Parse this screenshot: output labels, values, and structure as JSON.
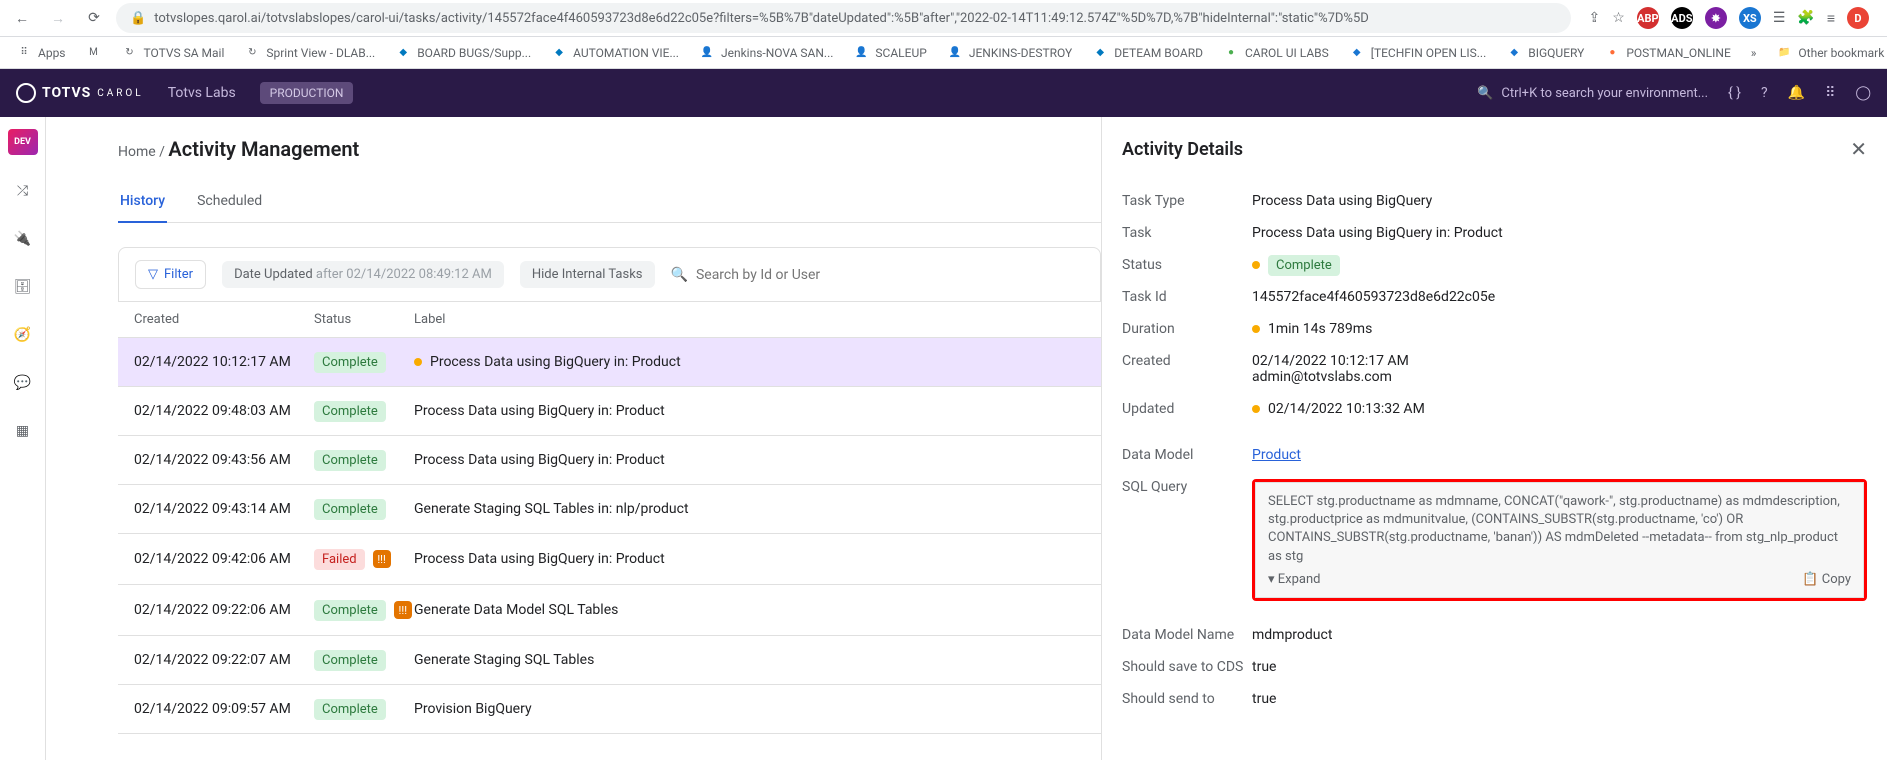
{
  "browser": {
    "url": "totvslopes.qarol.ai/totvslabslopes/carol-ui/tasks/activity/145572face4f460593723d8e6d22c05e?filters=%5B%7B\"dateUpdated\":%5B\"after\",\"2022-02-14T11:49:12.574Z\"%5D%7D,%7B\"hideInternal\":\"static\"%7D%5D",
    "other_bookmarks": "Other bookmark"
  },
  "bookmarks": {
    "apps": "Apps",
    "items": [
      "TOTVS SA Mail",
      "Sprint View - DLAB...",
      "BOARD BUGS/Supp...",
      "AUTOMATION VIE...",
      "Jenkins-NOVA SAN...",
      "SCALEUP",
      "JENKINS-DESTROY",
      "DETEAM BOARD",
      "CAROL UI LABS",
      "[TECHFIN OPEN LIS...",
      "BIGQUERY",
      "POSTMAN_ONLINE"
    ]
  },
  "header": {
    "brand": "TOTVS",
    "brand_sub": "CAROL",
    "org": "Totvs Labs",
    "env": "PRODUCTION",
    "search_placeholder": "Ctrl+K to search your environment..."
  },
  "page": {
    "home": "Home",
    "title": "Activity Management",
    "tabs": {
      "history": "History",
      "scheduled": "Scheduled"
    },
    "filter_label": "Filter",
    "date_chip_prefix": "Date Updated",
    "date_chip_after": "after 02/14/2022 08:49:12 AM",
    "hide_internal": "Hide Internal Tasks",
    "search_placeholder": "Search by Id or User"
  },
  "table": {
    "cols": {
      "created": "Created",
      "status": "Status",
      "label": "Label"
    },
    "rows": [
      {
        "created": "02/14/2022 10:12:17 AM",
        "status": "Complete",
        "status_type": "complete",
        "warn": false,
        "dot": true,
        "label": "Process Data using BigQuery in: Product",
        "selected": true
      },
      {
        "created": "02/14/2022 09:48:03 AM",
        "status": "Complete",
        "status_type": "complete",
        "warn": false,
        "dot": false,
        "label": "Process Data using BigQuery in: Product"
      },
      {
        "created": "02/14/2022 09:43:56 AM",
        "status": "Complete",
        "status_type": "complete",
        "warn": false,
        "dot": false,
        "label": "Process Data using BigQuery in: Product"
      },
      {
        "created": "02/14/2022 09:43:14 AM",
        "status": "Complete",
        "status_type": "complete",
        "warn": false,
        "dot": false,
        "label": "Generate Staging SQL Tables in: nlp/product"
      },
      {
        "created": "02/14/2022 09:42:06 AM",
        "status": "Failed",
        "status_type": "failed",
        "warn": true,
        "dot": false,
        "label": "Process Data using BigQuery in: Product"
      },
      {
        "created": "02/14/2022 09:22:06 AM",
        "status": "Complete",
        "status_type": "complete",
        "warn": true,
        "dot": false,
        "label": "Generate Data Model SQL Tables"
      },
      {
        "created": "02/14/2022 09:22:07 AM",
        "status": "Complete",
        "status_type": "complete",
        "warn": false,
        "dot": false,
        "label": "Generate Staging SQL Tables"
      },
      {
        "created": "02/14/2022 09:09:57 AM",
        "status": "Complete",
        "status_type": "complete",
        "warn": false,
        "dot": false,
        "label": "Provision BigQuery"
      }
    ]
  },
  "details": {
    "title": "Activity Details",
    "labels": {
      "task_type": "Task Type",
      "task": "Task",
      "status": "Status",
      "task_id": "Task Id",
      "duration": "Duration",
      "created": "Created",
      "updated": "Updated",
      "data_model": "Data Model",
      "sql_query": "SQL Query",
      "data_model_name": "Data Model Name",
      "save_cds": "Should save to CDS",
      "send_to": "Should send to"
    },
    "values": {
      "task_type": "Process Data using BigQuery",
      "task": "Process Data using BigQuery in: Product",
      "status": "Complete",
      "task_id": "145572face4f460593723d8e6d22c05e",
      "duration": "1min 14s 789ms",
      "created_time": "02/14/2022 10:12:17 AM",
      "created_user": "admin@totvslabs.com",
      "updated": "02/14/2022 10:13:32 AM",
      "data_model": "Product",
      "sql_query": "SELECT stg.productname as mdmname, CONCAT(\"qawork-\", stg.productname) as mdmdescription, stg.productprice as mdmunitvalue, (CONTAINS_SUBSTR(stg.productname, 'co') OR CONTAINS_SUBSTR(stg.productname, 'banan')) AS mdmDeleted --metadata-- from stg_nlp_product as stg",
      "data_model_name": "mdmproduct",
      "save_cds": "true",
      "send_to": "true"
    },
    "expand": "Expand",
    "copy": "Copy"
  }
}
